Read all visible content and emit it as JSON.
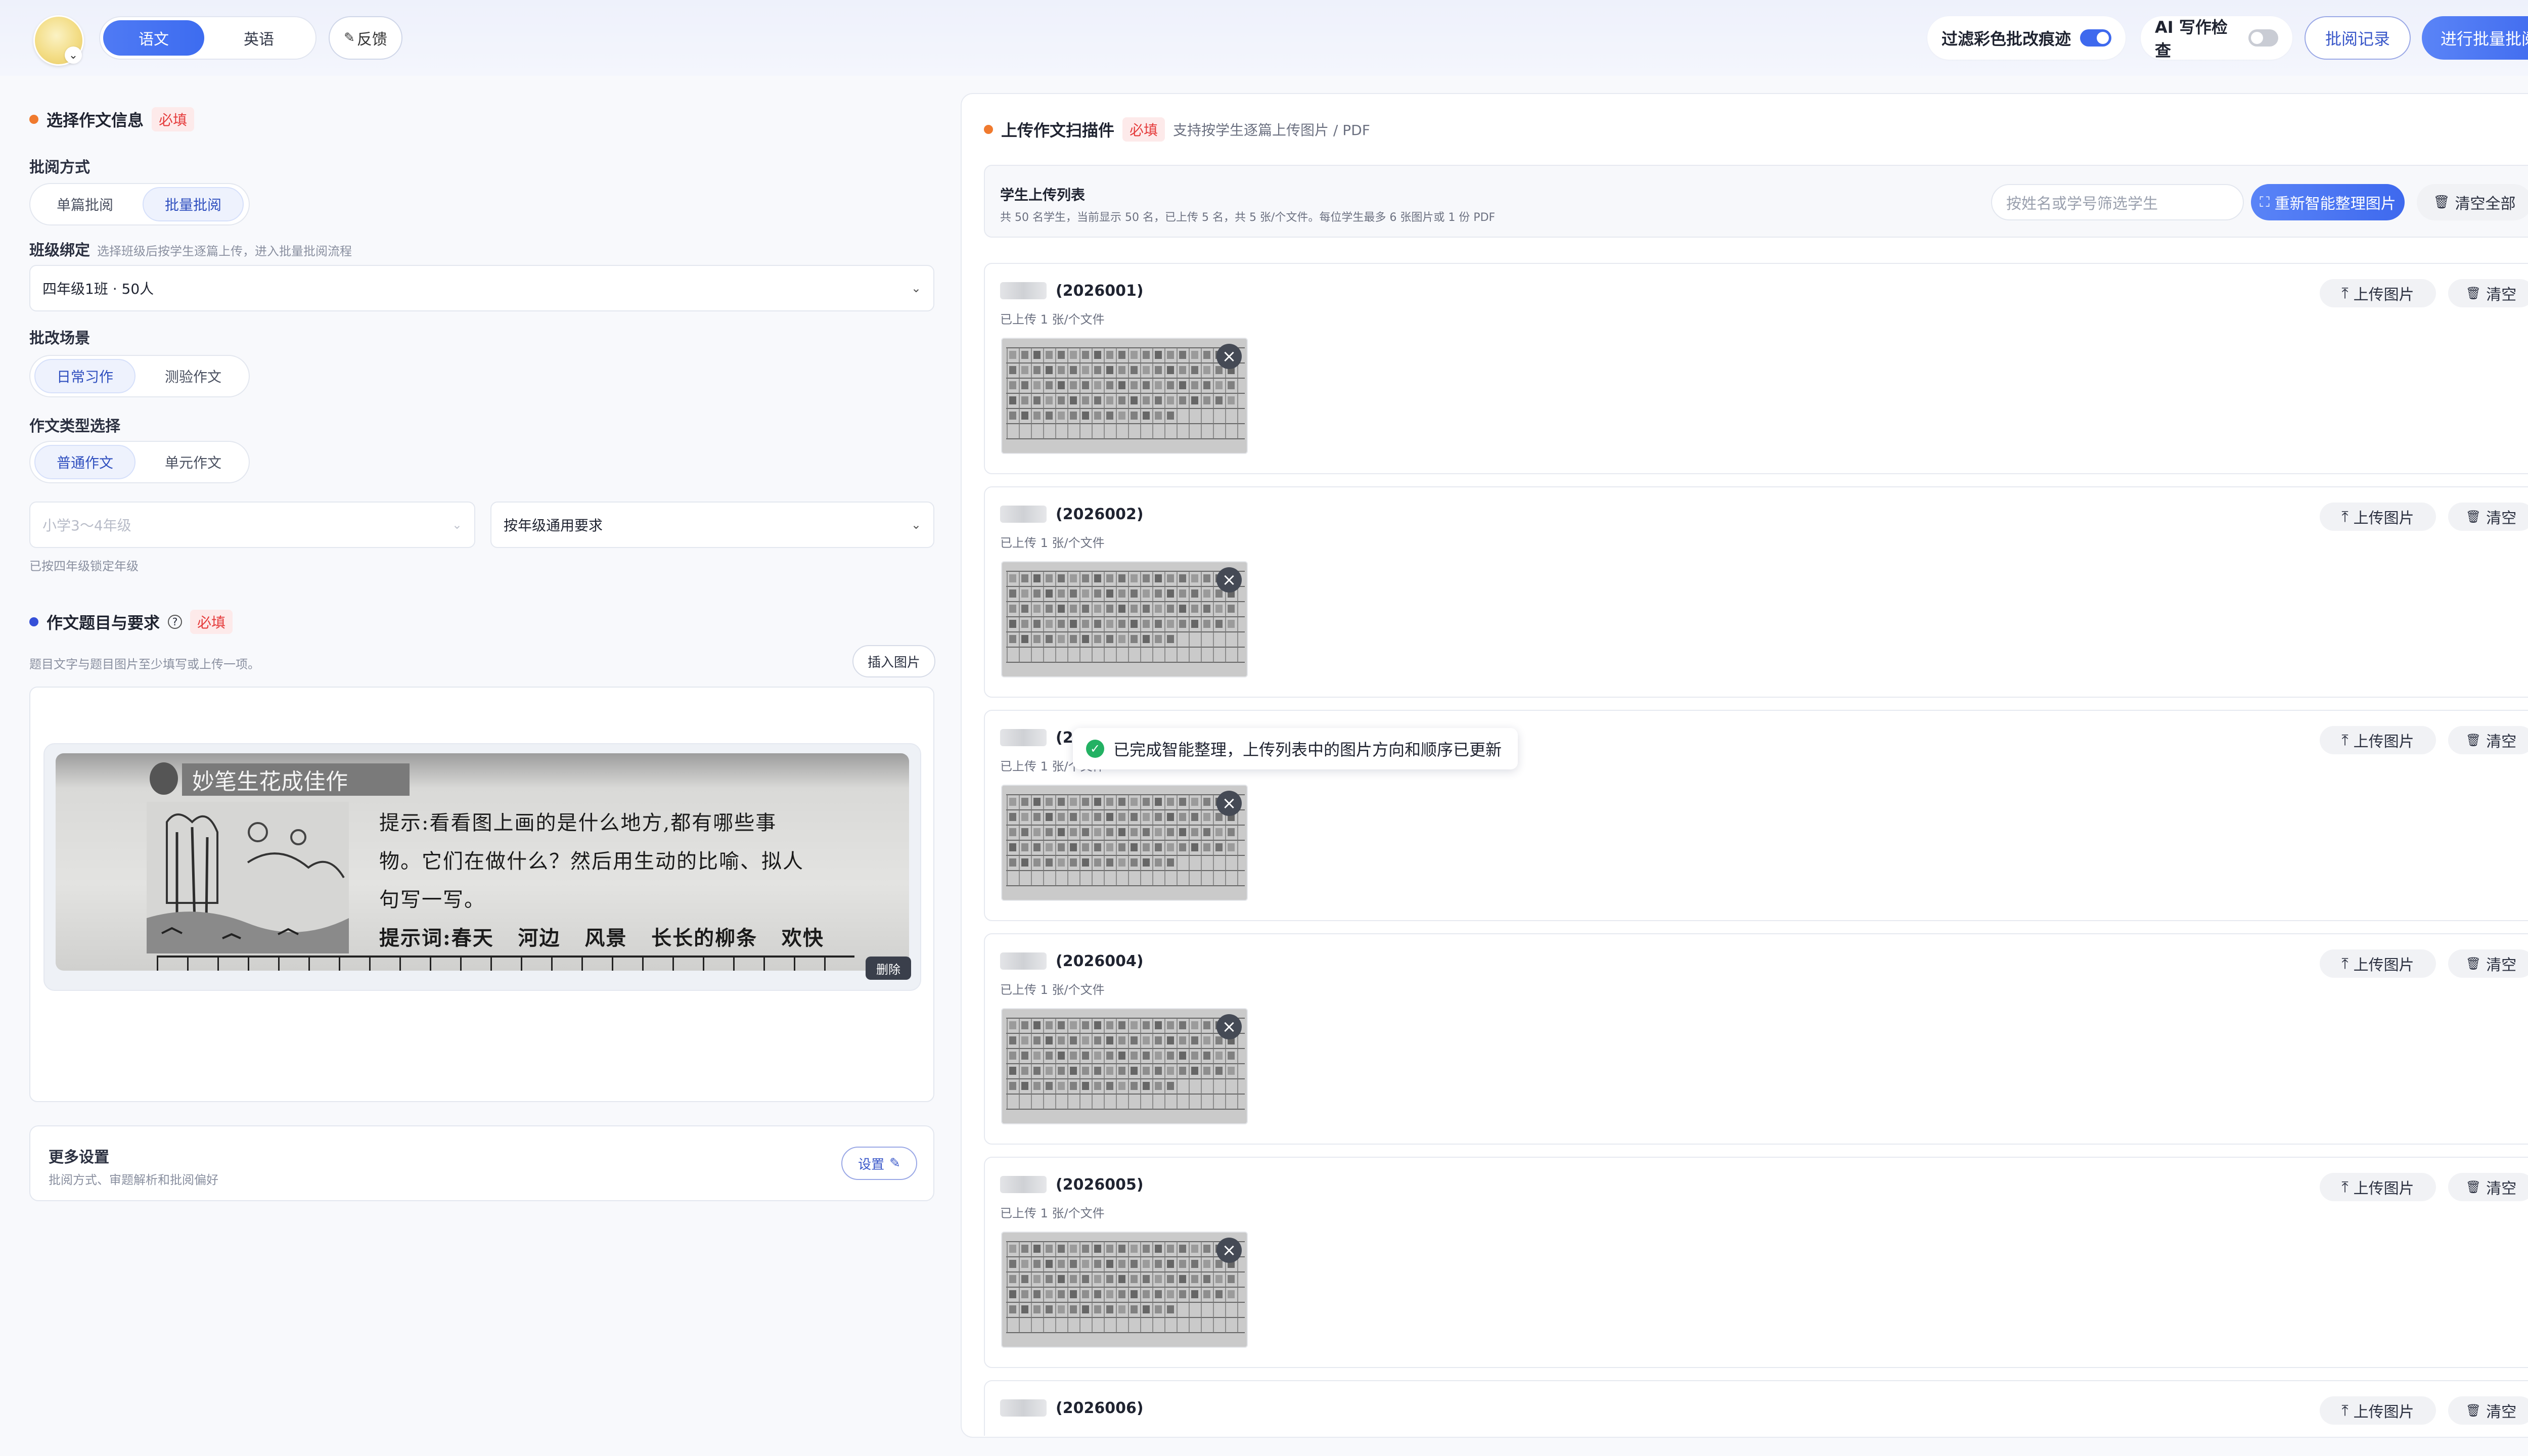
{
  "header": {
    "subjects": [
      "语文",
      "英语"
    ],
    "active_subject": "语文",
    "feedback_label": "反馈",
    "filter_marks_label": "过滤彩色批改痕迹",
    "filter_marks_on": true,
    "ai_check_label": "AI 写作检查",
    "ai_check_on": false,
    "history_label": "批阅记录",
    "batch_review_label": "进行批量批阅",
    "accent_color": "#3e69ee"
  },
  "left": {
    "section1_title": "选择作文信息",
    "required_tag": "必填",
    "review_mode_label": "批阅方式",
    "review_modes": [
      "单篇批阅",
      "批量批阅"
    ],
    "review_mode_active": "批量批阅",
    "class_label": "班级绑定",
    "class_hint": "选择班级后按学生逐篇上传，进入批量批阅流程",
    "class_value": "四年级1班 · 50人",
    "scene_label": "批改场景",
    "scenes": [
      "日常习作",
      "测验作文"
    ],
    "scene_active": "日常习作",
    "type_label": "作文类型选择",
    "types": [
      "普通作文",
      "单元作文"
    ],
    "type_active": "普通作文",
    "grade_placeholder": "小学3～4年级",
    "requirement_value": "按年级通用要求",
    "grade_locked_hint": "已按四年级锁定年级",
    "section2_title": "作文题目与要求",
    "prompt_hint": "题目文字与题目图片至少填写或上传一项。",
    "insert_image_label": "插入图片",
    "delete_label": "删除",
    "prompt_image": {
      "banner": "妙笔生花成佳作",
      "line1": "提示:看看图上画的是什么地方,都有哪些事",
      "line2": "物。它们在做什么？然后用生动的比喻、拟人",
      "line3": "句写一写。",
      "line4": "提示词:春天   河边   风景   长长的柳条   欢快"
    },
    "more_settings_title": "更多设置",
    "more_settings_desc": "批阅方式、审题解析和批阅偏好",
    "settings_label": "设置"
  },
  "right": {
    "title": "上传作文扫描件",
    "required_tag": "必填",
    "subtitle": "支持按学生逐篇上传图片 / PDF",
    "list_title": "学生上传列表",
    "list_desc": "共 50 名学生，当前显示 50 名，已上传 5 名，共 5 张/个文件。每位学生最多 6 张图片或 1 份 PDF",
    "search_placeholder": "按姓名或学号筛选学生",
    "smart_arrange_label": "重新智能整理图片",
    "clear_all_label": "清空全部",
    "upload_label": "上传图片",
    "clear_label": "清空",
    "students": [
      {
        "id": "(2026001)",
        "status": "已上传 1 张/个文件"
      },
      {
        "id": "(2026002)",
        "status": "已上传 1 张/个文件"
      },
      {
        "id": "(2026003)",
        "status": "已上传 1 张/个文件"
      },
      {
        "id": "(2026004)",
        "status": "已上传 1 张/个文件"
      },
      {
        "id": "(2026005)",
        "status": "已上传 1 张/个文件"
      },
      {
        "id": "(2026006)",
        "status": ""
      }
    ],
    "toast": "已完成智能整理，上传列表中的图片方向和顺序已更新"
  }
}
